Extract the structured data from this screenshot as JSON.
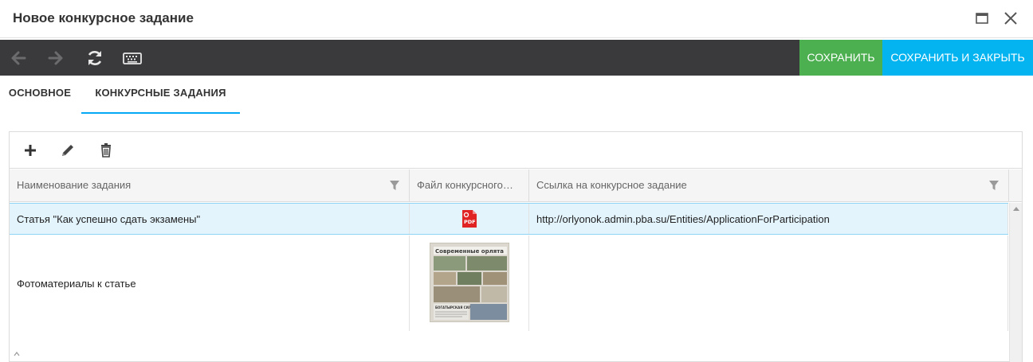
{
  "window": {
    "title": "Новое конкурсное задание",
    "maximize_icon": "maximize-icon",
    "close_icon": "close-icon"
  },
  "toolbar": {
    "icons": [
      "back-arrow-icon",
      "forward-arrow-icon",
      "refresh-icon",
      "keyboard-icon"
    ],
    "save_label": "СОХРАНИТЬ",
    "save_close_label": "СОХРАНИТЬ И ЗАКРЫТЬ",
    "save_color": "#4caf50",
    "save_close_color": "#03b4f0"
  },
  "tabs": [
    {
      "label": "ОСНОВНОЕ",
      "active": false
    },
    {
      "label": "КОНКУРСНЫЕ ЗАДАНИЯ",
      "active": true
    }
  ],
  "grid": {
    "toolbar_icons": [
      "add-icon",
      "edit-icon",
      "delete-icon"
    ],
    "columns": [
      {
        "label": "Наименование задания",
        "filter": true
      },
      {
        "label": "Файл конкурсного…",
        "filter": false
      },
      {
        "label": "Ссылка на конкурсное задание",
        "filter": true
      }
    ],
    "rows": [
      {
        "name": "Статья \"Как успешно сдать экзамены\"",
        "file": "pdf-file-icon",
        "link": "http://orlyonok.admin.pba.su/Entities/ApplicationForParticipation",
        "selected": true
      },
      {
        "name": "Фотоматериалы к статье",
        "file": "newspaper-photo-thumbnail",
        "link": "",
        "selected": false
      }
    ]
  },
  "thumbnail_text": {
    "headline": "Современные орлята",
    "caption": "БОГАТЫРСКАЯ СИЛА"
  },
  "accent_color": "#03a9f4",
  "selection_color": "#e3f4fd"
}
